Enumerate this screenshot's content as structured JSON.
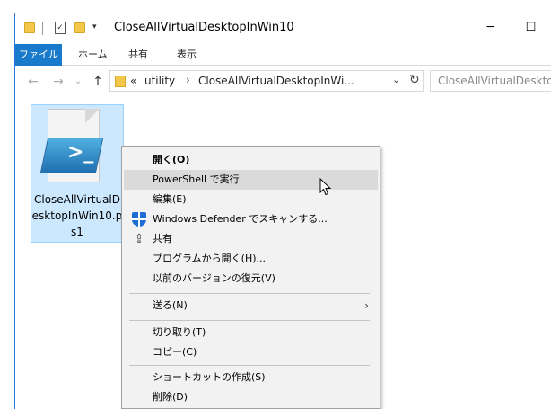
{
  "window": {
    "title": "CloseAllVirtualDesktopInWin10",
    "minimize_glyph": "─",
    "maximize_glyph": "☐"
  },
  "ribbon": {
    "tabs": [
      "ファイル",
      "ホーム",
      "共有",
      "表示"
    ]
  },
  "address": {
    "prefix": "«",
    "crumbs": [
      "utility",
      "CloseAllVirtualDesktopInWi..."
    ],
    "separator": "›",
    "dropdown_glyph": "⌄",
    "refresh_glyph": "↻"
  },
  "nav": {
    "back_glyph": "←",
    "forward_glyph": "→",
    "recent_glyph": "⌄",
    "up_glyph": "↑"
  },
  "search": {
    "placeholder": "CloseAllVirtualDeskto"
  },
  "file": {
    "name": "CloseAllVirtualDesktopInWin10.ps1",
    "icon": "powershell-script-icon"
  },
  "context_menu": {
    "items": [
      {
        "label": "開く(O)",
        "bold": true
      },
      {
        "label": "PowerShell で実行",
        "hover": true
      },
      {
        "label": "編集(E)"
      },
      {
        "label": "Windows Defender でスキャンする...",
        "icon": "windows-defender-icon"
      },
      {
        "label": "共有",
        "icon": "share-icon"
      },
      {
        "label": "プログラムから開く(H)..."
      },
      {
        "label": "以前のバージョンの復元(V)"
      },
      {
        "label": "送る(N)",
        "submenu": true
      },
      {
        "label": "切り取り(T)"
      },
      {
        "label": "コピー(C)"
      },
      {
        "label": "ショートカットの作成(S)"
      },
      {
        "label": "削除(D)"
      }
    ],
    "submenu_glyph": "›"
  },
  "colors": {
    "accent": "#1979ca",
    "selection_bg": "#cce8ff",
    "menu_bg": "#f2f2f2",
    "menu_hover": "#dadada"
  }
}
